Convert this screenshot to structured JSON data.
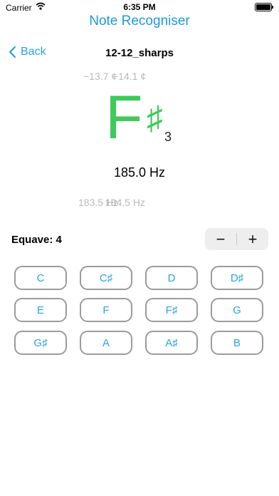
{
  "status_bar": {
    "carrier": "Carrier",
    "time": "6:35 PM"
  },
  "app_title": "Note Recogniser",
  "nav": {
    "back_label": "Back",
    "title": "12-12_sharps"
  },
  "ghost": {
    "cents_a": "−13.7 ¢",
    "cents_b": "−14.1 ¢",
    "hz_a": "183.5 Hz",
    "hz_b": "184.5 Hz"
  },
  "note": {
    "letter": "F",
    "accidental": "♯",
    "octave": "3",
    "color": "#3ec95a"
  },
  "frequency": "185.0 Hz",
  "equave": {
    "label": "Equave: 4",
    "minus": "−",
    "plus": "+"
  },
  "keys": [
    [
      "C",
      "C♯",
      "D",
      "D♯"
    ],
    [
      "E",
      "F",
      "F♯",
      "G"
    ],
    [
      "G♯",
      "A",
      "A♯",
      "B"
    ]
  ],
  "colors": {
    "accent": "#2aa3e6",
    "title": "#1a9ae0",
    "note": "#3ec95a"
  }
}
